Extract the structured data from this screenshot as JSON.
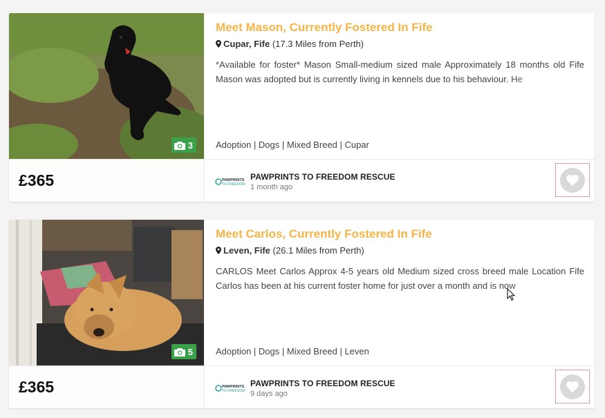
{
  "listings": [
    {
      "title": "Meet Mason, Currently Fostered In Fife",
      "location": "Cupar, Fife",
      "distance": "(17.3 Miles from Perth)",
      "description": "*Available for foster* Mason Small-medium sized male Approximately 18 months old Fife Mason was adopted but is currently living in kennels due to his behaviour. He",
      "tags": "Adoption | Dogs | Mixed Breed | Cupar",
      "photo_count": "3",
      "price": "£365",
      "org_name": "PAWPRINTS TO FREEDOM RESCUE",
      "posted": "1 month ago"
    },
    {
      "title": "Meet Carlos, Currently Fostered In Fife",
      "location": "Leven, Fife",
      "distance": "(26.1 Miles from Perth)",
      "description": "CARLOS Meet Carlos Approx 4-5 years old Medium sized cross breed male Location Fife Carlos has been at his current foster home for just over a month and is now",
      "tags": "Adoption | Dogs | Mixed Breed | Leven",
      "photo_count": "5",
      "price": "£365",
      "org_name": "PAWPRINTS TO FREEDOM RESCUE",
      "posted": "9 days ago"
    }
  ],
  "logo_text": "PAWPRINTS TO FREEDOM",
  "icons": {
    "location": "map-pin-icon",
    "photos": "camera-icon",
    "favourite": "heart-icon"
  },
  "colors": {
    "title": "#f5b547",
    "photo_badge": "#3aa14a",
    "favourite_border": "#c7443f"
  }
}
